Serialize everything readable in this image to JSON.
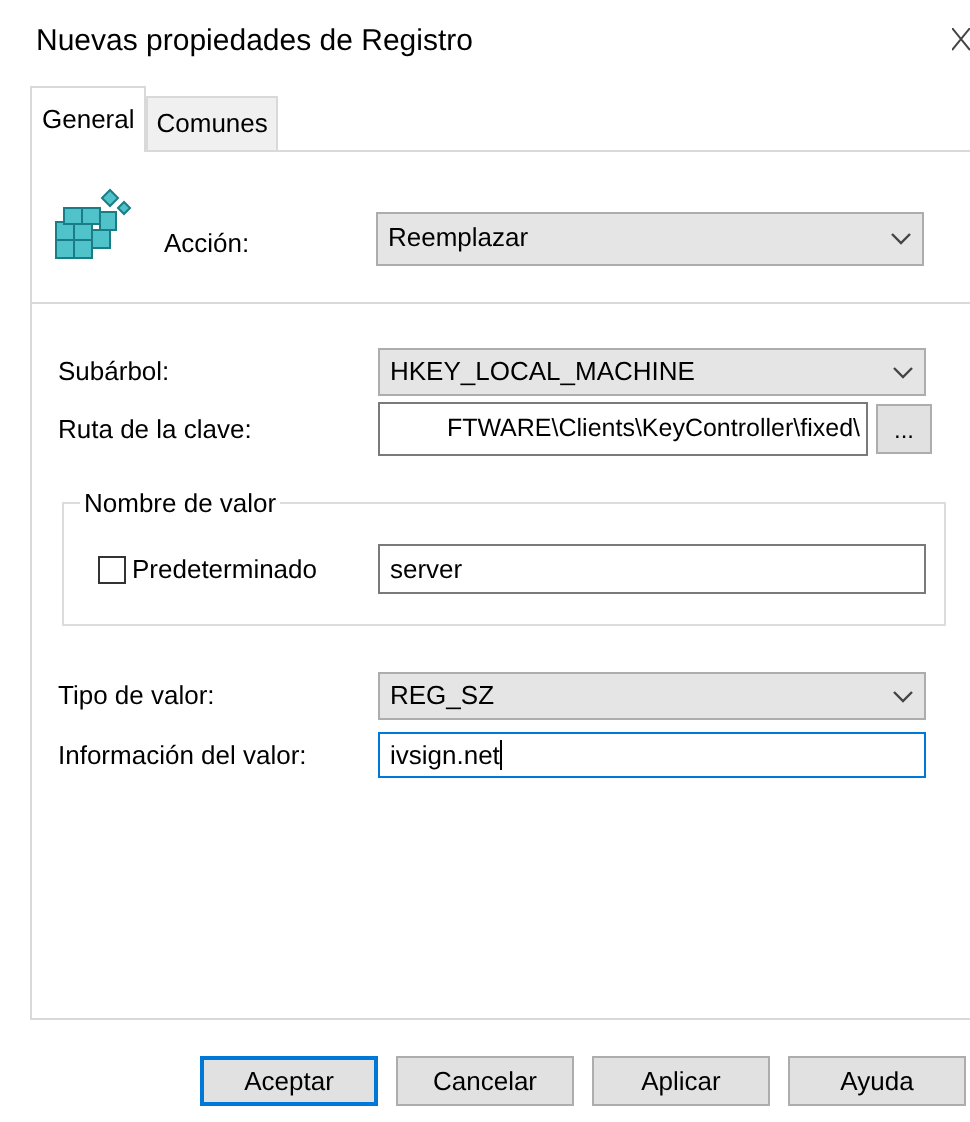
{
  "window": {
    "title": "Nuevas propiedades de Registro"
  },
  "tabs": [
    {
      "label": "General",
      "selected": true
    },
    {
      "label": "Comunes",
      "selected": false
    }
  ],
  "action": {
    "label": "Acción:",
    "value": "Reemplazar"
  },
  "hive": {
    "label": "Subárbol:",
    "value": "HKEY_LOCAL_MACHINE"
  },
  "key_path": {
    "label": "Ruta de la clave:",
    "value": "FTWARE\\Clients\\KeyController\\fixed\\",
    "browse": "..."
  },
  "value_name": {
    "group": "Nombre de valor",
    "default_label": "Predeterminado",
    "default_checked": false,
    "value": "server"
  },
  "value_type": {
    "label": "Tipo de valor:",
    "value": "REG_SZ"
  },
  "value_data": {
    "label": "Información del valor:",
    "value": "ivsign.net",
    "focused": true
  },
  "buttons": [
    {
      "label": "Aceptar",
      "default": true
    },
    {
      "label": "Cancelar",
      "default": false
    },
    {
      "label": "Aplicar",
      "default": false
    },
    {
      "label": "Ayuda",
      "default": false
    }
  ]
}
